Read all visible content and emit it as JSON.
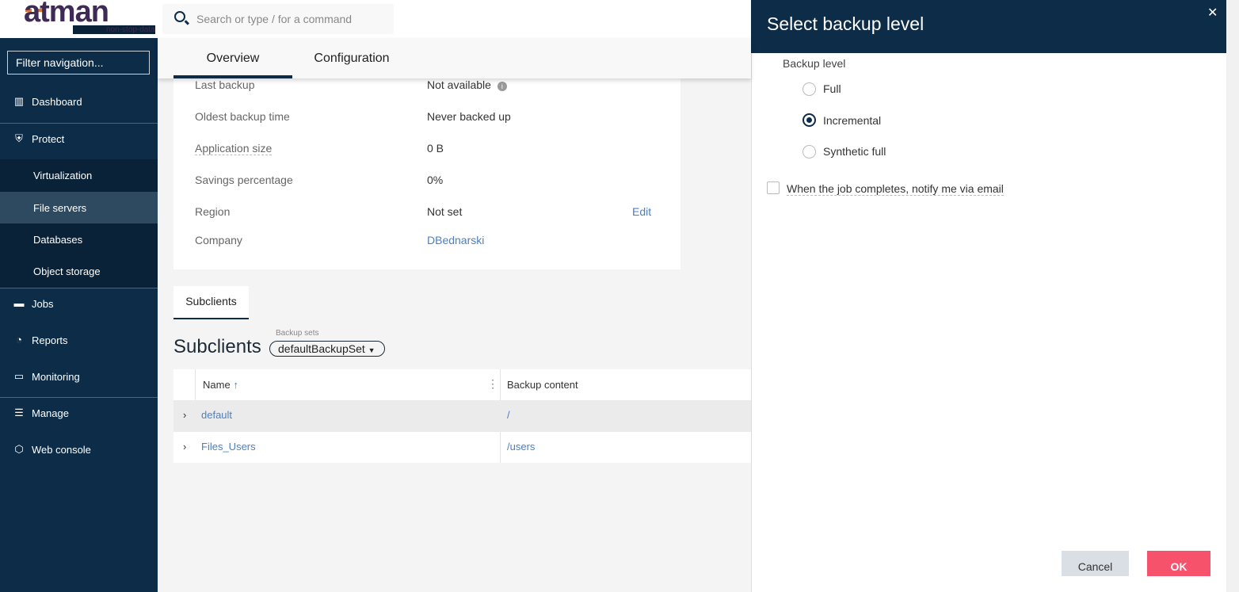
{
  "logo": {
    "brand": "atman",
    "tagline": "non-stop-data"
  },
  "search": {
    "placeholder": "Search or type / for a command"
  },
  "sidebar": {
    "filter_placeholder": "Filter navigation...",
    "items": [
      {
        "label": "Dashboard",
        "icon": "dashboard-icon"
      },
      {
        "label": "Protect",
        "icon": "shield-icon"
      },
      {
        "label": "Virtualization"
      },
      {
        "label": "File servers",
        "selected": true
      },
      {
        "label": "Databases"
      },
      {
        "label": "Object storage"
      },
      {
        "label": "Jobs",
        "icon": "briefcase-icon"
      },
      {
        "label": "Reports",
        "icon": "reports-icon"
      },
      {
        "label": "Monitoring",
        "icon": "monitor-icon"
      },
      {
        "label": "Manage",
        "icon": "sliders-icon"
      },
      {
        "label": "Web console",
        "icon": "cube-icon"
      }
    ]
  },
  "tabs": [
    {
      "label": "Overview",
      "active": true
    },
    {
      "label": "Configuration"
    }
  ],
  "details": [
    {
      "label": "Last backup",
      "value": "Not available"
    },
    {
      "label": "Oldest backup time",
      "value": "Never backed up"
    },
    {
      "label": "Application size",
      "value": "0 B"
    },
    {
      "label": "Savings percentage",
      "value": "0%"
    },
    {
      "label": "Region",
      "value": "Not set",
      "action": "Edit"
    },
    {
      "label": "Company",
      "value": "DBednarski"
    }
  ],
  "subclients": {
    "tab": "Subclients",
    "title": "Subclients",
    "backup_sets_label": "Backup sets",
    "backup_set": "defaultBackupSet",
    "columns": [
      "Name",
      "Backup content"
    ],
    "rows": [
      {
        "name": "default",
        "content": "/"
      },
      {
        "name": "Files_Users",
        "content": "/users"
      }
    ]
  },
  "panel": {
    "title": "Select backup level",
    "level_label": "Backup level",
    "options": [
      "Full",
      "Incremental",
      "Synthetic full"
    ],
    "selected": "Incremental",
    "notify_label": "When the job completes, notify me via email",
    "notify_checked": false,
    "cancel": "Cancel",
    "ok": "OK"
  },
  "colors": {
    "navy": "#0d2c47",
    "ok": "#f6526c",
    "link": "#4a7fc1"
  }
}
